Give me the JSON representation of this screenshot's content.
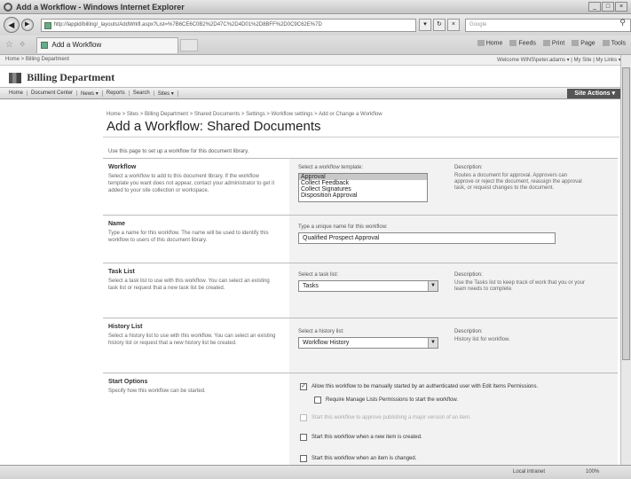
{
  "window": {
    "title": "Add a Workflow - Windows Internet Explorer"
  },
  "addressbar": {
    "url": "http://lappid/billing/_layouts/AddWrkfl.aspx?List=%7B6CE6C0B2%2D47C%2D4D01%2D8BFF%2D0C9C62E%7D",
    "search_placeholder": "Google"
  },
  "tabbar": {
    "tab_label": "Add a Workflow",
    "commands": [
      "Home",
      "Feeds",
      "Print",
      "Page",
      "Tools"
    ]
  },
  "sharepoint": {
    "top_left": "Home > Billing Department",
    "top_right": "Welcome WINS\\peter.adams ▾ | My Site | My Links ▾ |",
    "site_name": "Billing Department",
    "nav_items": [
      "Home",
      "Document Center",
      "News ▾",
      "Reports",
      "Search",
      "Sites ▾"
    ],
    "site_actions": "Site Actions ▾"
  },
  "page": {
    "breadcrumb": "Home > Sites > Billing Department > Shared Documents > Settings > Workflow settings > Add or Change a Workflow",
    "title": "Add a Workflow: Shared Documents",
    "intro": "Use this page to set up a workflow for this document library."
  },
  "workflow_section": {
    "heading": "Workflow",
    "help": "Select a workflow to add to this document library. If the workflow template you want does not appear, contact your administrator to get it added to your site collection or workspace.",
    "template_label": "Select a workflow template:",
    "templates": [
      "Approval",
      "Collect Feedback",
      "Collect Signatures",
      "Disposition Approval"
    ],
    "selected_template": "Approval",
    "description_label": "Description:",
    "description": "Routes a document for approval. Approvers can approve or reject the document, reassign the approval task, or request changes to the document."
  },
  "name_section": {
    "heading": "Name",
    "help": "Type a name for this workflow. The name will be used to identify this workflow to users of this document library.",
    "input_label": "Type a unique name for this workflow:",
    "input_value": "Qualified Prospect Approval"
  },
  "tasklist_section": {
    "heading": "Task List",
    "help": "Select a task list to use with this workflow. You can select an existing task list or request that a new task list be created.",
    "select_label": "Select a task list:",
    "select_value": "Tasks",
    "description_label": "Description:",
    "description": "Use the Tasks list to keep track of work that you or your team needs to complete."
  },
  "historylist_section": {
    "heading": "History List",
    "help": "Select a history list to use with this workflow. You can select an existing history list or request that a new history list be created.",
    "select_label": "Select a history list:",
    "select_value": "Workflow History",
    "description_label": "Description:",
    "description": "History list for workflow."
  },
  "startoptions_section": {
    "heading": "Start Options",
    "help": "Specify how this workflow can be started.",
    "options": [
      {
        "label": "Allow this workflow to be manually started by an authenticated user with Edit Items Permissions.",
        "checked": true,
        "disabled": false
      },
      {
        "label": "Require Manage Lists Permissions to start the workflow.",
        "checked": false,
        "disabled": false
      },
      {
        "label": "Start this workflow to approve publishing a major version of an item.",
        "checked": false,
        "disabled": true
      },
      {
        "label": "Start this workflow when a new item is created.",
        "checked": false,
        "disabled": false
      },
      {
        "label": "Start this workflow when an item is changed.",
        "checked": false,
        "disabled": false
      }
    ]
  },
  "statusbar": {
    "zone": "Local intranet",
    "zoom": "100%"
  },
  "colors": {
    "site_actions_bg": "#555555",
    "right_pane_bg": "#f2f2f2",
    "selected_item_bg": "#c8c8c8"
  }
}
